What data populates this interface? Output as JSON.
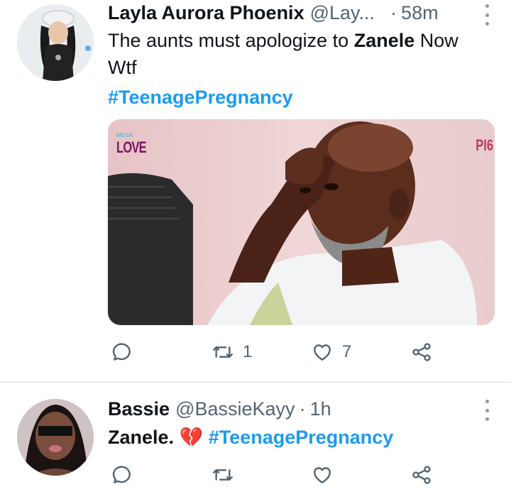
{
  "tweets": [
    {
      "name": "Layla Aurora Phoenix",
      "handle": "@Lay...",
      "dot": "·",
      "time": "58m",
      "text_before": "The aunts must apologize to ",
      "text_bold": "Zanele",
      "text_after": " Now",
      "text_line2": "Wtf",
      "hashtag": "#TeenagePregnancy",
      "media": {
        "watermark_top": "MOJA",
        "watermark_main": "LOVE",
        "watermark_right": "PI6"
      },
      "actions": {
        "reply": "",
        "retweet": "1",
        "like": "7",
        "share": ""
      }
    },
    {
      "name": "Bassie",
      "handle": "@BassieKayy",
      "dot": "·",
      "time": "1h",
      "text": "Zanele.",
      "emoji": "💔",
      "hashtag": "#TeenagePregnancy",
      "actions": {
        "reply": "",
        "retweet": "",
        "like": "",
        "share": ""
      }
    }
  ],
  "colors": {
    "hashtag": "#1d9bf0",
    "secondary_text": "#536471",
    "primary_text": "#0f1419",
    "divider": "#e9ecef",
    "heart_emoji": "#c81e3a"
  },
  "icons": [
    "reply-icon",
    "retweet-icon",
    "like-icon",
    "share-icon",
    "more-options-icon"
  ]
}
